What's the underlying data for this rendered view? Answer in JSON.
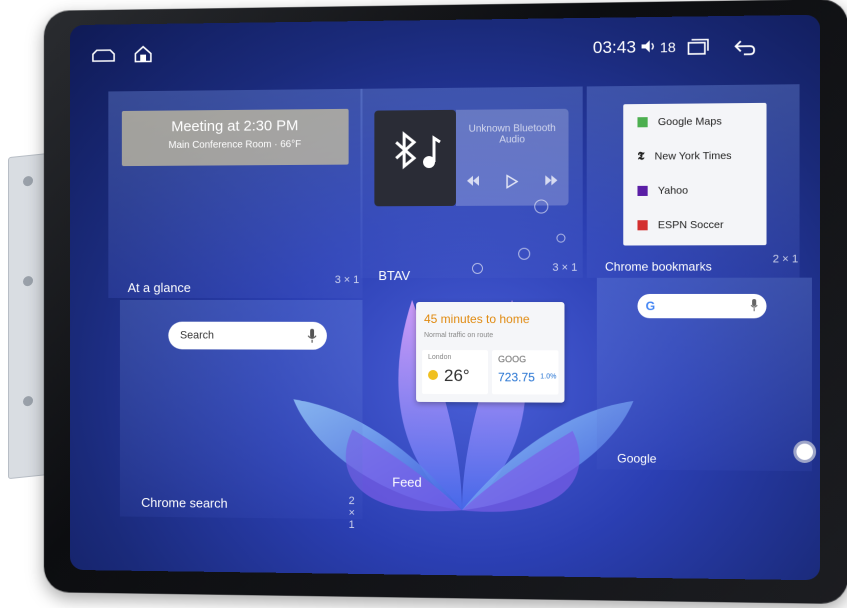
{
  "status_bar": {
    "time": "03:43",
    "volume": "18"
  },
  "tiles": {
    "at_a_glance": {
      "label": "At a glance",
      "size": "3 × 1",
      "meeting_title": "Meeting at 2:30 PM",
      "meeting_sub": "Main Conference Room · 66°F"
    },
    "btav": {
      "label": "BTAV",
      "size": "3 × 1",
      "media_title": "Unknown Bluetooth Audio"
    },
    "bookmarks": {
      "label": "Chrome bookmarks",
      "size": "2 × 1",
      "items": [
        "Google Maps",
        "New York Times",
        "Yahoo",
        "ESPN Soccer"
      ]
    },
    "chrome_search": {
      "label": "Chrome search",
      "size": "2 × 1",
      "placeholder": "Search"
    },
    "feed": {
      "label": "Feed",
      "traffic_title": "45 minutes to home",
      "traffic_sub": "Normal traffic on route",
      "weather_city": "London",
      "weather_temp": "26°",
      "stock_symbol": "GOOG",
      "stock_price": "723.75",
      "stock_change": "1.0%"
    },
    "google": {
      "label": "Google",
      "size": "2 × 1",
      "g_letter": "G"
    }
  },
  "colors": {
    "accent_orange": "#f0a020",
    "stock_blue": "#1f6fd1"
  }
}
